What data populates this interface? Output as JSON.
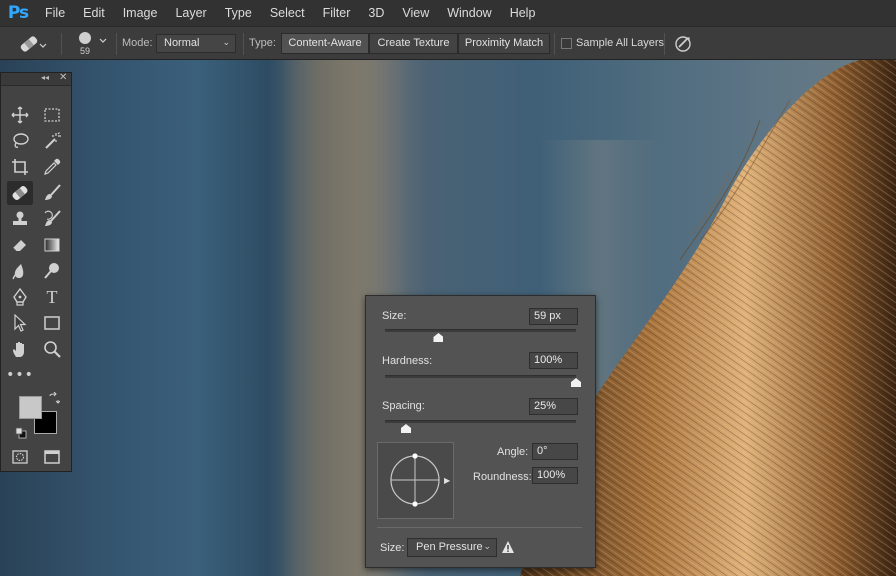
{
  "app": {
    "logo": "Ps"
  },
  "menu": [
    "File",
    "Edit",
    "Image",
    "Layer",
    "Type",
    "Select",
    "Filter",
    "3D",
    "View",
    "Window",
    "Help"
  ],
  "options_bar": {
    "brush_size_value": "59",
    "mode_label": "Mode:",
    "mode_value": "Normal",
    "type_label": "Type:",
    "type_options": [
      "Content-Aware",
      "Create Texture",
      "Proximity Match"
    ],
    "type_selected": "Content-Aware",
    "sample_all_layers_label": "Sample All Layers",
    "sample_all_layers_checked": false
  },
  "tools_panel": {
    "tools": [
      "move-tool",
      "marquee-tool",
      "lasso-tool",
      "magic-wand-tool",
      "crop-tool",
      "eyedropper-tool",
      "spot-healing-brush-tool",
      "brush-tool",
      "clone-stamp-tool",
      "history-brush-tool",
      "eraser-tool",
      "gradient-tool",
      "blur-tool",
      "dodge-tool",
      "pen-tool",
      "type-tool",
      "path-selection-tool",
      "rectangle-tool",
      "hand-tool",
      "zoom-tool",
      "edit-toolbar",
      "foreground-color",
      "background-color",
      "quick-mask",
      "screen-mode"
    ],
    "active_tool": "spot-healing-brush-tool",
    "foreground_color": "#c8c8c8",
    "background_color": "#000000"
  },
  "brush_popup": {
    "size_label": "Size:",
    "size_value": "59 px",
    "size_slider": 0.28,
    "hardness_label": "Hardness:",
    "hardness_value": "100%",
    "hardness_slider": 1.0,
    "spacing_label": "Spacing:",
    "spacing_value": "25%",
    "spacing_slider": 0.11,
    "angle_label": "Angle:",
    "angle_value": "0°",
    "roundness_label": "Roundness:",
    "roundness_value": "100%",
    "size_control_label": "Size:",
    "size_control_value": "Pen Pressure"
  },
  "colors": {
    "accent": "#31a8ff",
    "ui_bg": "#3c3c3c",
    "panel_bg": "#535353"
  }
}
